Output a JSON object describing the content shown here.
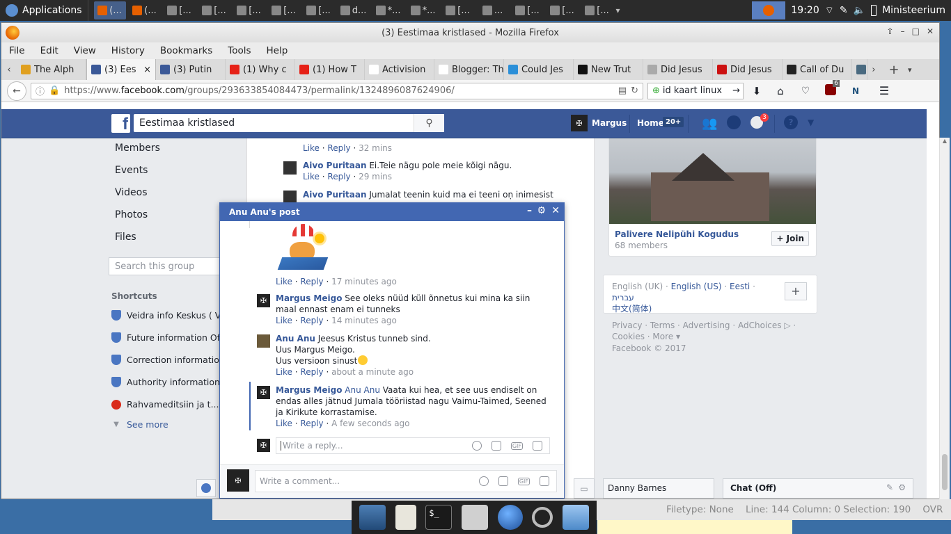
{
  "taskbar": {
    "apps_label": "Applications",
    "tasks": [
      "(...",
      "(...",
      "[...",
      "[...",
      "[...",
      "[...",
      "[...",
      "d...",
      "*...",
      "*...",
      "[...",
      "...",
      "[...",
      "[...",
      "[..."
    ],
    "clock": "19:20",
    "user": "Ministeerium"
  },
  "window": {
    "title": "(3) Eestimaa kristlased - Mozilla Firefox"
  },
  "menubar": [
    "File",
    "Edit",
    "View",
    "History",
    "Bookmarks",
    "Tools",
    "Help"
  ],
  "tabs": [
    {
      "label": "The Alph",
      "color": "#e0a020"
    },
    {
      "label": "(3) Ees",
      "color": "#3b5998",
      "selected": true,
      "close": "×"
    },
    {
      "label": "(3) Putin",
      "color": "#3b5998"
    },
    {
      "label": "(1) Why c",
      "color": "#e62117"
    },
    {
      "label": "(1) How T",
      "color": "#e62117"
    },
    {
      "label": "Activision",
      "color": "#ffffff"
    },
    {
      "label": "Blogger: The",
      "color": "#ffffff"
    },
    {
      "label": "Could Jes",
      "color": "#2b8fd8"
    },
    {
      "label": "New Trut",
      "color": "#111111"
    },
    {
      "label": "Did Jesus",
      "color": "#aaaaaa"
    },
    {
      "label": "Did Jesus",
      "color": "#cc1111"
    },
    {
      "label": "Call of Du",
      "color": "#222222"
    },
    {
      "label": "",
      "color": "#4a6a80"
    }
  ],
  "tabbar": {
    "new_tab": "+"
  },
  "navbar": {
    "url_prefix": "https://www.",
    "url_domain": "facebook.com",
    "url_path": "/groups/293633854084473/permalink/1324896087624906/",
    "search_value": "id kaart linux",
    "ublock_count": "6"
  },
  "fb_header": {
    "search_value": "Eestimaa kristlased",
    "user_name": "Margus",
    "home_label": "Home",
    "home_badge": "20+",
    "notif_badge": "3"
  },
  "left_nav": {
    "items": [
      "Members",
      "Events",
      "Videos",
      "Photos",
      "Files"
    ],
    "search_placeholder": "Search this group",
    "shortcuts_title": "Shortcuts",
    "shortcuts": [
      "Veidra info Keskus ( V",
      "Future information Offi",
      "Correction information",
      "Authority information A",
      "Rahvameditsiin ja t..."
    ],
    "see_more": "See more"
  },
  "feed_comments": [
    {
      "name": "",
      "text": "",
      "like": "Like",
      "reply": "Reply",
      "time": "32 mins"
    },
    {
      "name": "Aivo Puritaan",
      "text": "Ei.Teie nägu pole meie kõigi nägu.",
      "like": "Like",
      "reply": "Reply",
      "time": "29 mins"
    },
    {
      "name": "Aivo Puritaan",
      "text": "Jumalat teenin kuid ma ei teeni oṇ inimesist"
    }
  ],
  "right_col": {
    "group_name": "Palivere Nelipühi Kogudus",
    "members": "68 members",
    "join": "+ Join",
    "langs": [
      "English (UK)",
      "English (US)",
      "Eesti",
      "עברית",
      "中文(简体)"
    ],
    "lang_add": "+",
    "footer_links": "Privacy · Terms · Advertising · AdChoices ▷ ·",
    "footer_links2": "Cookies · More ▾",
    "copyright": "Facebook © 2017",
    "chat_contact": "Danny Barnes",
    "chat_status": "Chat (Off)"
  },
  "chat_popup": {
    "title": "Anu Anu's post",
    "comments": [
      {
        "name": "",
        "text": "",
        "like": "Like",
        "reply": "Reply",
        "time": "17 minutes ago"
      },
      {
        "name": "Margus Meigo",
        "text": "See oleks nüüd küll õnnetus kui mina ka siin maal ennast enam ei tunneks",
        "like": "Like",
        "reply": "Reply",
        "time": "14 minutes ago"
      },
      {
        "name": "Anu Anu",
        "text": "Jeesus Kristus tunneb sind.",
        "line2": "Uus Margus Meigo.",
        "line3": "Uus versioon sinust",
        "like": "Like",
        "reply": "Reply",
        "time": "about a minute ago"
      },
      {
        "name": "Margus Meigo",
        "mention": "Anu Anu",
        "text": "Vaata kui hea, et see uus endiselt on endas alles jätnud Jumala tööriistad nagu Vaimu-Taimed, Seened ja Kirikute korrastamise.",
        "like": "Like",
        "reply": "Reply",
        "time": "A few seconds ago"
      }
    ],
    "reply_placeholder": "Write a reply...",
    "comment_placeholder": "Write a comment...",
    "gif": "GIF"
  },
  "background_app": {
    "status": "Filetype: None    Line: 144 Column: 0 Selection: 190    OVR"
  }
}
